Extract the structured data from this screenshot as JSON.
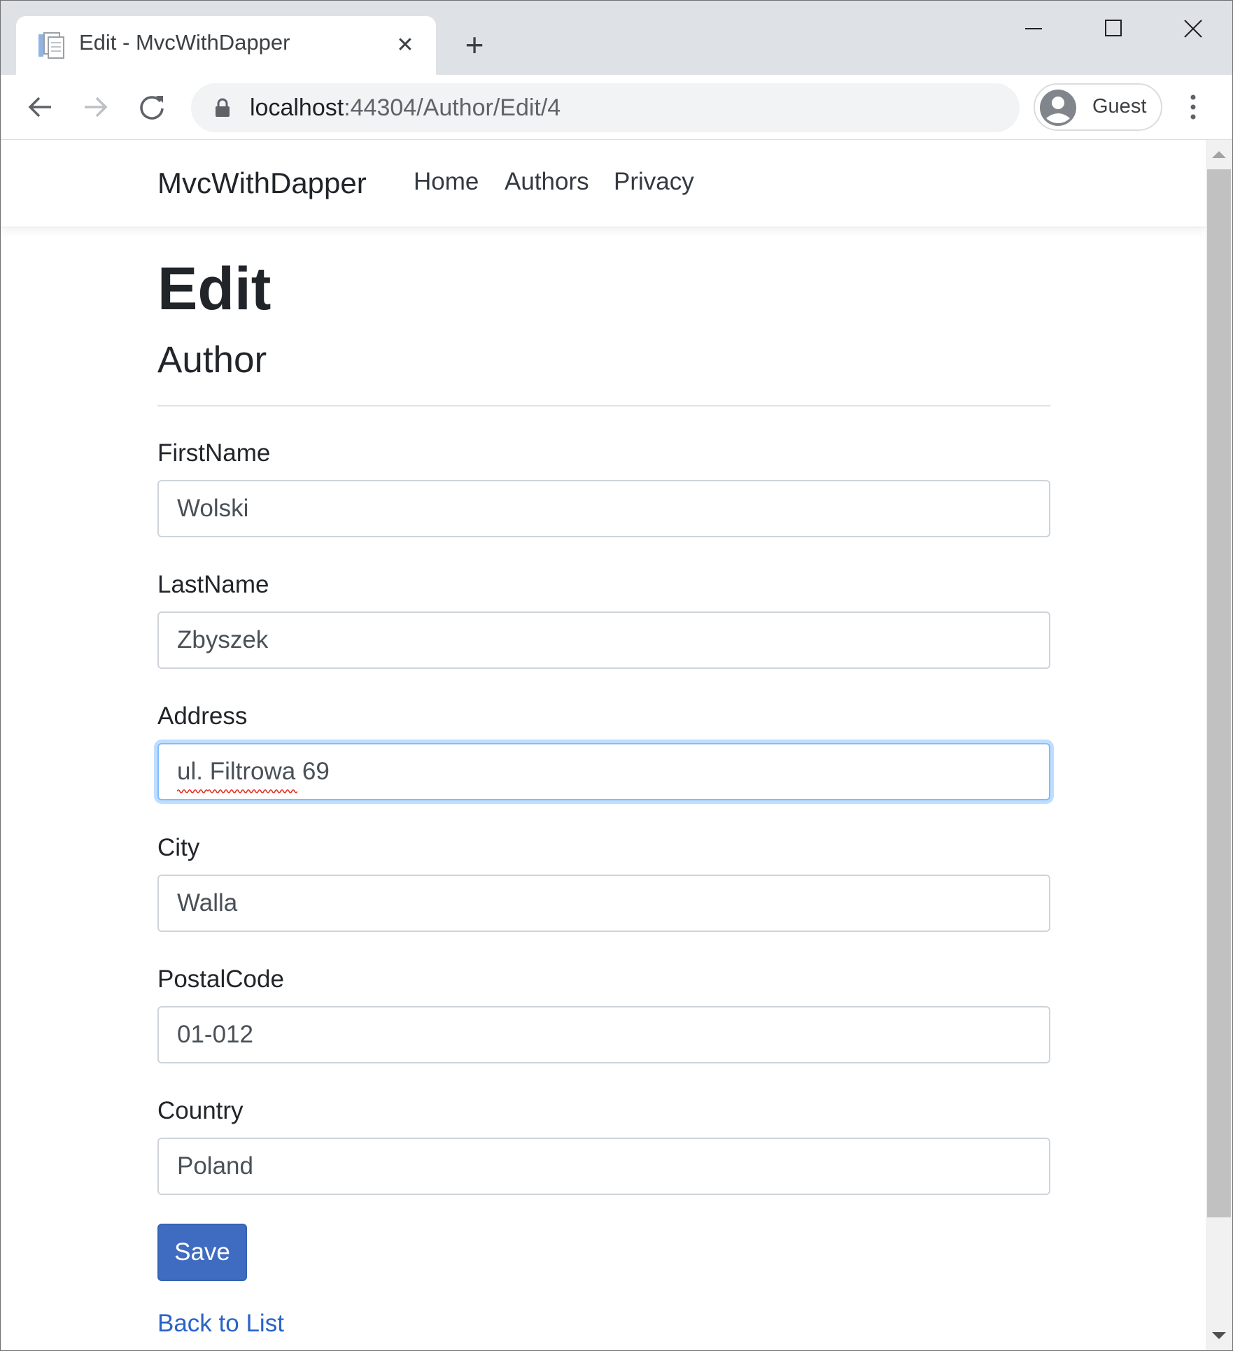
{
  "browser": {
    "tab_title": "Edit - MvcWithDapper",
    "url_host": "localhost",
    "url_path": ":44304/Author/Edit/4",
    "profile_label": "Guest"
  },
  "site": {
    "brand": "MvcWithDapper",
    "nav": [
      "Home",
      "Authors",
      "Privacy"
    ]
  },
  "page": {
    "title": "Edit",
    "subtitle": "Author"
  },
  "form": {
    "fields": [
      {
        "label": "FirstName",
        "value": "Wolski"
      },
      {
        "label": "LastName",
        "value": "Zbyszek"
      },
      {
        "label": "Address",
        "value": "ul. Filtrowa 69",
        "focused": true
      },
      {
        "label": "City",
        "value": "Walla"
      },
      {
        "label": "PostalCode",
        "value": "01-012"
      },
      {
        "label": "Country",
        "value": "Poland"
      }
    ],
    "save_label": "Save",
    "back_label": "Back to List"
  },
  "colors": {
    "tabstrip": "#dee1e6",
    "primary_button": "#3f6cc0",
    "link": "#2a63c8",
    "focus_border": "#80bdff"
  }
}
